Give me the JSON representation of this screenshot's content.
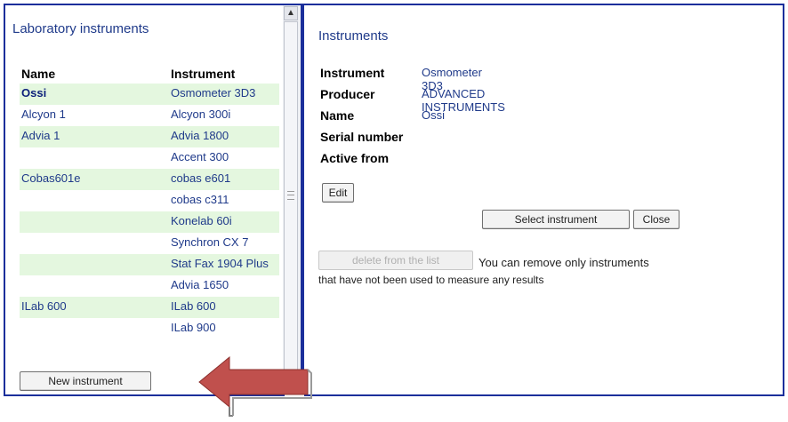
{
  "left_panel": {
    "title": "Laboratory instruments",
    "columns": [
      "Name",
      "Instrument"
    ],
    "rows": [
      {
        "name": "Ossi",
        "instrument": "Osmometer 3D3",
        "selected": true
      },
      {
        "name": "Alcyon 1",
        "instrument": "Alcyon 300i"
      },
      {
        "name": "Advia 1",
        "instrument": "Advia 1800"
      },
      {
        "name": "",
        "instrument": "Accent 300"
      },
      {
        "name": "Cobas601e",
        "instrument": "cobas e601"
      },
      {
        "name": "",
        "instrument": "cobas c311"
      },
      {
        "name": "",
        "instrument": "Konelab 60i"
      },
      {
        "name": "",
        "instrument": "Synchron CX 7"
      },
      {
        "name": "",
        "instrument": "Stat Fax 1904 Plus"
      },
      {
        "name": "",
        "instrument": "Advia 1650"
      },
      {
        "name": "ILab 600",
        "instrument": "ILab 600"
      },
      {
        "name": "",
        "instrument": "ILab 900"
      }
    ],
    "new_button": "New instrument"
  },
  "right_panel": {
    "title": "Instruments",
    "details": [
      {
        "label": "Instrument",
        "value": "Osmometer 3D3"
      },
      {
        "label": "Producer",
        "value": "ADVANCED INSTRUMENTS"
      },
      {
        "label": "Name",
        "value": "Ossi"
      },
      {
        "label": "Serial number",
        "value": ""
      },
      {
        "label": "Active from",
        "value": ""
      }
    ],
    "edit_button": "Edit",
    "select_button": "Select instrument",
    "close_button": "Close",
    "delete_button": "delete from the list",
    "delete_note_1": "You can remove only instruments",
    "delete_note_2": "that have not been used to measure any results"
  },
  "colors": {
    "border": "#1b2f9b",
    "row_highlight": "#e4f7df",
    "arrow_fill": "#c0504d"
  },
  "icons": {
    "scroll_up": "chevron-up-icon",
    "annotation_arrow": "arrow-left-icon"
  }
}
